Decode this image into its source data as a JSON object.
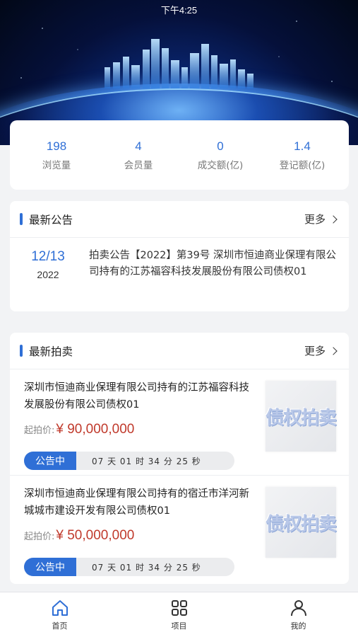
{
  "status_bar": {
    "time": "下午4:25"
  },
  "stats": [
    {
      "value": "198",
      "label": "浏览量"
    },
    {
      "value": "4",
      "label": "会员量"
    },
    {
      "value": "0",
      "label": "成交额(亿)"
    },
    {
      "value": "1.4",
      "label": "登记额(亿)"
    }
  ],
  "notice_section": {
    "title": "最新公告",
    "more": "更多",
    "item": {
      "date_md": "12/13",
      "date_year": "2022",
      "text": "拍卖公告【2022】第39号 深圳市恒迪商业保理有限公司持有的江苏福容科技发展股份有限公司债权01"
    }
  },
  "auction_section": {
    "title": "最新拍卖",
    "more": "更多",
    "items": [
      {
        "title": "深圳市恒迪商业保理有限公司持有的江苏福容科技发展股份有限公司债权01",
        "price_label": "起拍价:",
        "price": "¥ 90,000,000",
        "status": "公告中",
        "countdown": "07 天 01 时 34 分 25 秒",
        "thumb_text": "债权拍卖"
      },
      {
        "title": "深圳市恒迪商业保理有限公司持有的宿迁市洋河新城城市建设开发有限公司债权01",
        "price_label": "起拍价:",
        "price": "¥ 50,000,000",
        "status": "公告中",
        "countdown": "07 天 01 时 34 分 25 秒",
        "thumb_text": "债权拍卖"
      }
    ]
  },
  "tabbar": [
    {
      "label": "首页",
      "icon": "home-icon",
      "active": true
    },
    {
      "label": "项目",
      "icon": "grid-icon",
      "active": false
    },
    {
      "label": "我的",
      "icon": "user-icon",
      "active": false
    }
  ],
  "colors": {
    "accent": "#2f6fd6",
    "price": "#c0392b"
  }
}
